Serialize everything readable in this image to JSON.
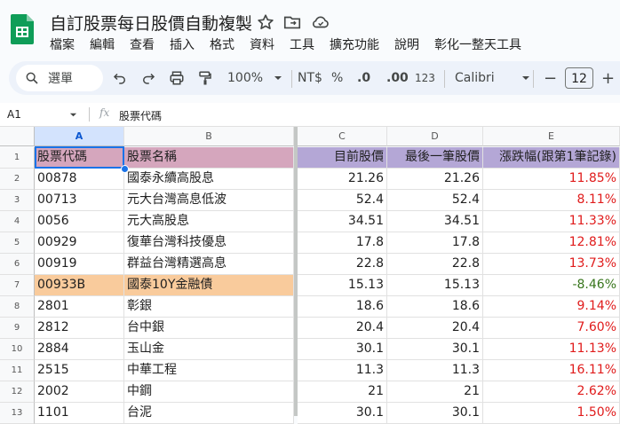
{
  "app": {
    "doc_title": "自訂股票每日股價自動複製",
    "menu": [
      "檔案",
      "編輯",
      "查看",
      "插入",
      "格式",
      "資料",
      "工具",
      "擴充功能",
      "說明",
      "彰化一整天工具"
    ]
  },
  "toolbar": {
    "search_label": "選單",
    "zoom": "100%",
    "currency": "NT$",
    "percent": "%",
    "dec_decrease": ".0",
    "dec_increase": ".00",
    "number_format": "123",
    "font": "Calibri",
    "font_size": "12",
    "minus": "−",
    "plus": "+"
  },
  "formula_bar": {
    "cell_ref": "A1",
    "fx": "fx",
    "content": "股票代碼"
  },
  "columns": [
    "A",
    "B",
    "C",
    "D",
    "E"
  ],
  "header_row": {
    "row_num": "1",
    "cells": [
      "股票代碼",
      "股票名稱",
      "目前股價",
      "最後一筆股價",
      "漲跌幅(跟第1筆記錄)"
    ]
  },
  "rows": [
    {
      "n": "2",
      "code": "00878",
      "name": "國泰永續高股息",
      "cur": "21.26",
      "last": "21.26",
      "chg": "11.85%",
      "sign": "pos"
    },
    {
      "n": "3",
      "code": "00713",
      "name": "元大台灣高息低波",
      "cur": "52.4",
      "last": "52.4",
      "chg": "8.11%",
      "sign": "pos"
    },
    {
      "n": "4",
      "code": "0056",
      "name": "元大高股息",
      "cur": "34.51",
      "last": "34.51",
      "chg": "11.33%",
      "sign": "pos"
    },
    {
      "n": "5",
      "code": "00929",
      "name": "復華台灣科技優息",
      "cur": "17.8",
      "last": "17.8",
      "chg": "12.81%",
      "sign": "pos"
    },
    {
      "n": "6",
      "code": "00919",
      "name": "群益台灣精選高息",
      "cur": "22.8",
      "last": "22.8",
      "chg": "13.73%",
      "sign": "pos"
    },
    {
      "n": "7",
      "code": "00933B",
      "name": "國泰10Y金融債",
      "cur": "15.13",
      "last": "15.13",
      "chg": "-8.46%",
      "sign": "neg"
    },
    {
      "n": "8",
      "code": "2801",
      "name": "彰銀",
      "cur": "18.6",
      "last": "18.6",
      "chg": "9.14%",
      "sign": "pos"
    },
    {
      "n": "9",
      "code": "2812",
      "name": "台中銀",
      "cur": "20.4",
      "last": "20.4",
      "chg": "7.60%",
      "sign": "pos"
    },
    {
      "n": "10",
      "code": "2884",
      "name": "玉山金",
      "cur": "30.1",
      "last": "30.1",
      "chg": "11.13%",
      "sign": "pos"
    },
    {
      "n": "11",
      "code": "2515",
      "name": "中華工程",
      "cur": "11.3",
      "last": "11.3",
      "chg": "16.11%",
      "sign": "pos"
    },
    {
      "n": "12",
      "code": "2002",
      "name": "中鋼",
      "cur": "21",
      "last": "21",
      "chg": "2.62%",
      "sign": "pos"
    },
    {
      "n": "13",
      "code": "1101",
      "name": "台泥",
      "cur": "30.1",
      "last": "30.1",
      "chg": "1.50%",
      "sign": "pos"
    }
  ],
  "colors": {
    "header_ab": "#d5a6bd",
    "header_cde": "#b4a7d6",
    "highlight_row": "#f9cb9c",
    "selection": "#1a73e8",
    "positive": "#e01b1b",
    "negative": "#38761d",
    "sheets_green": "#0f9d58"
  }
}
